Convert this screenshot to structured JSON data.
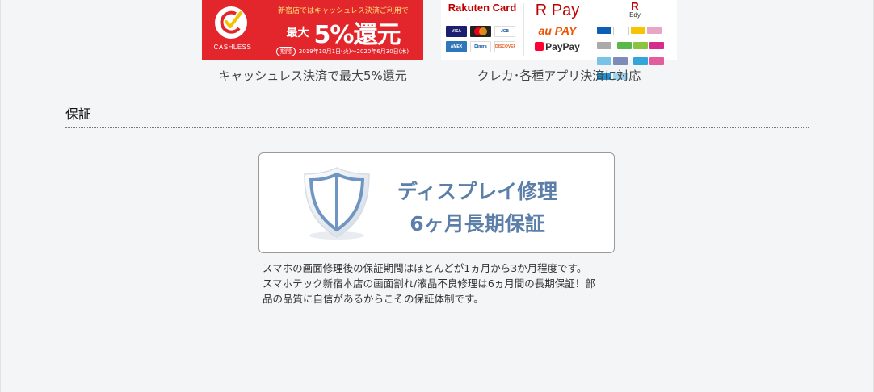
{
  "banners": {
    "cashless": {
      "logo_text": "CASHLESS",
      "headline": "新宿店ではキャッシュレス決済ご利用で",
      "saidai": "最大",
      "percent": "5%還元",
      "period_label": "期間",
      "period": "2019年10月1日(火)〜2020年6月30日(木)"
    },
    "cards": {
      "rakuten_card": "Rakuten Card",
      "brands": [
        "VISA",
        "mastercard",
        "JCB",
        "AMEX",
        "Diners Club",
        "DISCOVER"
      ],
      "rpay": "R Pay",
      "aupay": "au PAY",
      "paypay": "PayPay",
      "edy_r": "R",
      "edy": "Edy"
    }
  },
  "captions": {
    "left": "キャッシュレス決済で最大5%還元",
    "right": "クレカ･各種アプリ決済に対応"
  },
  "section": {
    "title": "保証"
  },
  "warranty": {
    "line1": "ディスプレイ修理",
    "line2": "6ヶ月長期保証"
  },
  "description": {
    "line1": "スマホの画面修理後の保証期間はほとんどが1ヵ月から3か月程度です。",
    "line2": "スマホテック新宿本店の画面割れ/液晶不良修理は6ヵ月間の長期保証！部",
    "line3": "品の品質に自信があるからこその保証体制です。"
  },
  "colors": {
    "cashless_red": "#e3262c",
    "rakuten_red": "#bf0000",
    "warranty_blue": "#5b7fa8",
    "background": "#f4f5f7"
  }
}
